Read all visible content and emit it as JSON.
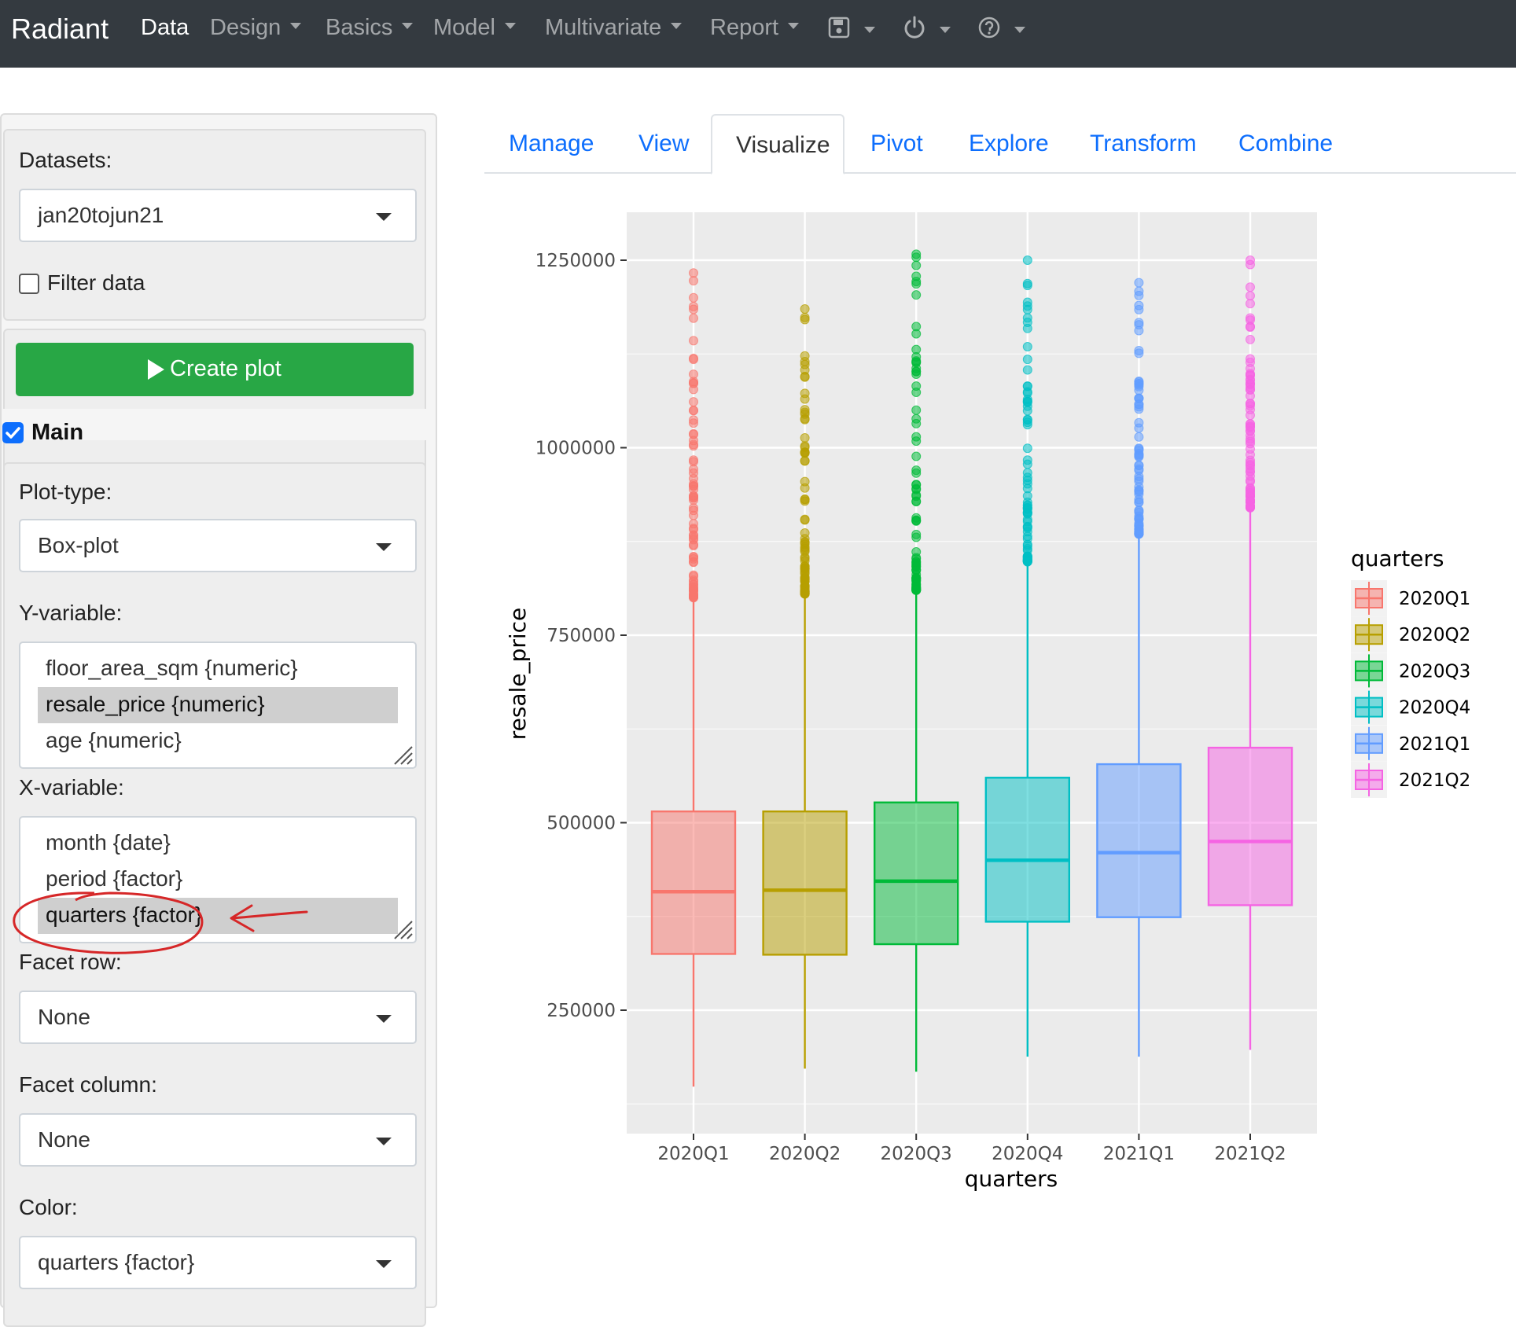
{
  "navbar": {
    "brand": "Radiant",
    "items": [
      {
        "label": "Data",
        "active": true,
        "dropdown": false
      },
      {
        "label": "Design",
        "active": false,
        "dropdown": true
      },
      {
        "label": "Basics",
        "active": false,
        "dropdown": true
      },
      {
        "label": "Model",
        "active": false,
        "dropdown": true
      },
      {
        "label": "Multivariate",
        "active": false,
        "dropdown": true
      },
      {
        "label": "Report",
        "active": false,
        "dropdown": true
      }
    ],
    "icons": [
      "save-icon",
      "power-icon",
      "help-icon"
    ]
  },
  "tabs": {
    "items": [
      "Manage",
      "View",
      "Visualize",
      "Pivot",
      "Explore",
      "Transform",
      "Combine"
    ],
    "active": "Visualize"
  },
  "sidebar": {
    "datasets_label": "Datasets:",
    "dataset_value": "jan20tojun21",
    "filter_label": "Filter data",
    "filter_checked": false,
    "create_plot_label": "Create plot",
    "main_label": "Main",
    "main_checked": true,
    "plot_type_label": "Plot-type:",
    "plot_type_value": "Box-plot",
    "y_var_label": "Y-variable:",
    "y_options": [
      "floor_area_sqm {numeric}",
      "resale_price {numeric}",
      "age {numeric}"
    ],
    "y_selected": "resale_price {numeric}",
    "x_var_label": "X-variable:",
    "x_options": [
      "month {date}",
      "period {factor}",
      "quarters {factor}"
    ],
    "x_selected": "quarters {factor}",
    "facet_row_label": "Facet row:",
    "facet_row_value": "None",
    "facet_col_label": "Facet column:",
    "facet_col_value": "None",
    "color_label": "Color:",
    "color_value": "quarters {factor}",
    "annotation_color": "#d62728"
  },
  "chart_data": {
    "type": "box",
    "xlabel": "quarters",
    "ylabel": "resale_price",
    "categories": [
      "2020Q1",
      "2020Q2",
      "2020Q3",
      "2020Q4",
      "2021Q1",
      "2021Q2"
    ],
    "ylim": [
      125000,
      1320000
    ],
    "yticks": [
      250000,
      500000,
      750000,
      1000000,
      1250000
    ],
    "ytick_labels": [
      "250000",
      "500000",
      "750000",
      "1000000",
      "1250000"
    ],
    "legend_title": "quarters",
    "legend_position": "right",
    "colors": [
      "#F8766D",
      "#B79F00",
      "#00BA38",
      "#00BFC4",
      "#619CFF",
      "#F564E3"
    ],
    "boxes": [
      {
        "name": "2020Q1",
        "min": 148000,
        "q1": 325000,
        "median": 408000,
        "q3": 515000,
        "whisker_high": 800000,
        "max": 1233000
      },
      {
        "name": "2020Q2",
        "min": 172000,
        "q1": 324000,
        "median": 410000,
        "q3": 515000,
        "whisker_high": 805000,
        "max": 1185000
      },
      {
        "name": "2020Q3",
        "min": 168000,
        "q1": 338000,
        "median": 422000,
        "q3": 527000,
        "whisker_high": 810000,
        "max": 1258000
      },
      {
        "name": "2020Q4",
        "min": 188000,
        "q1": 368000,
        "median": 450000,
        "q3": 560000,
        "whisker_high": 848000,
        "max": 1250000
      },
      {
        "name": "2021Q1",
        "min": 188000,
        "q1": 374000,
        "median": 460000,
        "q3": 578000,
        "whisker_high": 885000,
        "max": 1220000
      },
      {
        "name": "2021Q2",
        "min": 197000,
        "q1": 390000,
        "median": 475000,
        "q3": 600000,
        "whisker_high": 920000,
        "max": 1250000
      }
    ]
  }
}
